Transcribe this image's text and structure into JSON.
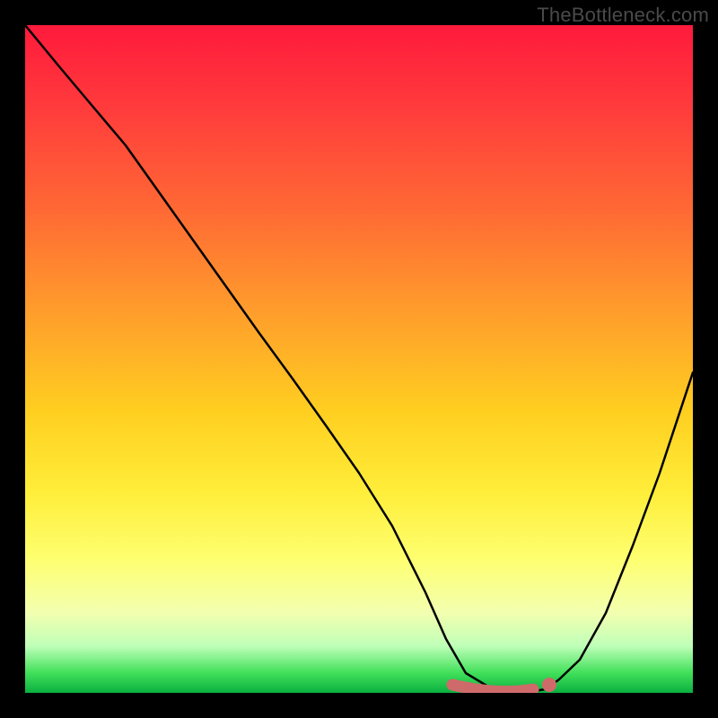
{
  "watermark": "TheBottleneck.com",
  "colors": {
    "background": "#000000",
    "curve": "#000000",
    "marker_stroke": "#d46a6a",
    "marker_fill": "#d46a6a",
    "gradient_top": "#ff1a3c",
    "gradient_bottom": "#0ab03f"
  },
  "chart_data": {
    "type": "line",
    "title": "",
    "xlabel": "",
    "ylabel": "",
    "xlim": [
      0,
      100
    ],
    "ylim": [
      0,
      100
    ],
    "grid": false,
    "series": [
      {
        "name": "bottleneck-curve",
        "x": [
          0,
          5,
          10,
          15,
          20,
          25,
          30,
          35,
          40,
          45,
          50,
          55,
          60,
          63,
          66,
          70,
          74,
          78,
          80,
          83,
          87,
          91,
          95,
          100
        ],
        "values": [
          100,
          94,
          88,
          82,
          75,
          68,
          61,
          54,
          47,
          40,
          33,
          25,
          15,
          8,
          3,
          0.5,
          0,
          0.5,
          2,
          5,
          12,
          22,
          33,
          48
        ]
      }
    ],
    "markers": [
      {
        "name": "optimal-range-left",
        "x": 64,
        "y": 1.2
      },
      {
        "name": "optimal-range-right",
        "x": 78,
        "y": 1.2
      },
      {
        "name": "optimal-segment-start",
        "x": 64,
        "y": 1.2
      },
      {
        "name": "optimal-segment-end",
        "x": 76,
        "y": 0.8
      }
    ],
    "annotations": []
  }
}
